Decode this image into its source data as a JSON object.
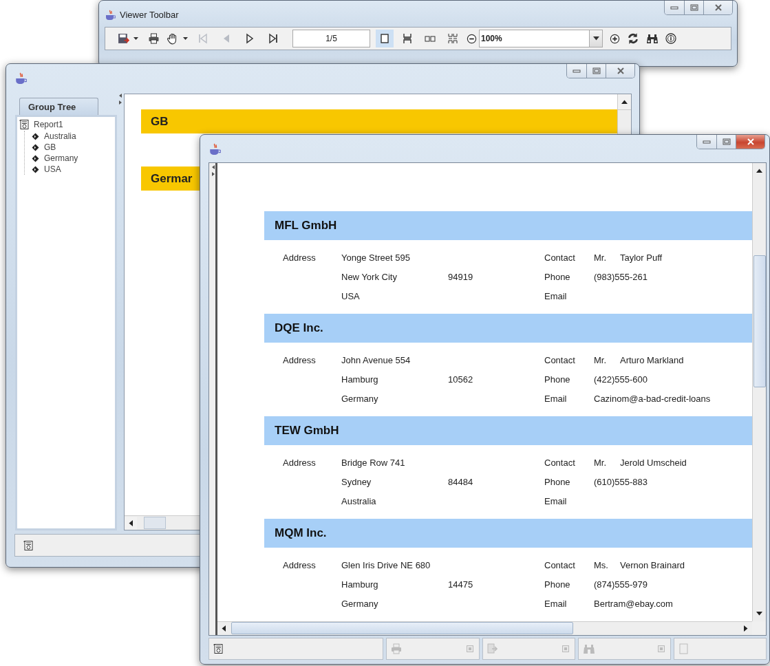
{
  "toolbar_window": {
    "title": "Viewer Toolbar",
    "nav_buttons": [
      {
        "kind": "first",
        "disabled": true
      },
      {
        "kind": "previous",
        "disabled": true
      },
      {
        "kind": "next",
        "disabled": false
      },
      {
        "kind": "last",
        "disabled": false
      }
    ],
    "page_field": {
      "value": "1/5"
    },
    "view_modes": [
      {
        "kind": "single",
        "selected": true
      },
      {
        "kind": "continuous",
        "selected": false
      },
      {
        "kind": "facing",
        "selected": false
      },
      {
        "kind": "multiple",
        "selected": false
      }
    ],
    "zoom_combo": {
      "value": "100%"
    }
  },
  "group_window": {
    "tab": {
      "label": "Group Tree",
      "selected": true
    },
    "tree": {
      "label": "Report1",
      "children": [
        {
          "label": "Australia"
        },
        {
          "label": "GB"
        },
        {
          "label": "Germany"
        },
        {
          "label": "USA"
        }
      ]
    },
    "report_bands": [
      {
        "label": "GB"
      },
      {
        "label": "Germar"
      }
    ]
  },
  "report_window": {
    "companies": [
      {
        "name": "MFL GmbH",
        "address_label": "Address",
        "street": "Yonge Street 595",
        "city": "New York City",
        "zip": "94919",
        "country": "USA",
        "contact_label": "Contact",
        "contact_title": "Mr.",
        "contact_name": "Taylor Puff",
        "phone_label": "Phone",
        "phone": "(983)555-261",
        "email_label": "Email"
      },
      {
        "name": "DQE Inc.",
        "address_label": "Address",
        "street": "John Avenue 554",
        "city": "Hamburg",
        "zip": "10562",
        "country": "Germany",
        "contact_label": "Contact",
        "contact_title": "Mr.",
        "contact_name": "Arturo Markland",
        "phone_label": "Phone",
        "phone": "(422)555-600",
        "email_label": "Email",
        "email": "Cazinom@a-bad-credit-loans"
      },
      {
        "name": "TEW GmbH",
        "address_label": "Address",
        "street": "Bridge Row 741",
        "city": "Sydney",
        "zip": "84484",
        "country": "Australia",
        "contact_label": "Contact",
        "contact_title": "Mr.",
        "contact_name": "Jerold Umscheid",
        "phone_label": "Phone",
        "phone": "(610)555-883",
        "email_label": "Email"
      },
      {
        "name": "MQM Inc.",
        "address_label": "Address",
        "street": "Glen Iris Drive NE 680",
        "city": "Hamburg",
        "zip": "14475",
        "country": "Germany",
        "contact_label": "Contact",
        "contact_title": "Ms.",
        "contact_name": "Vernon Brainard",
        "phone_label": "Phone",
        "phone": "(874)555-979",
        "email_label": "Email",
        "email": "Bertram@ebay.com"
      }
    ]
  }
}
